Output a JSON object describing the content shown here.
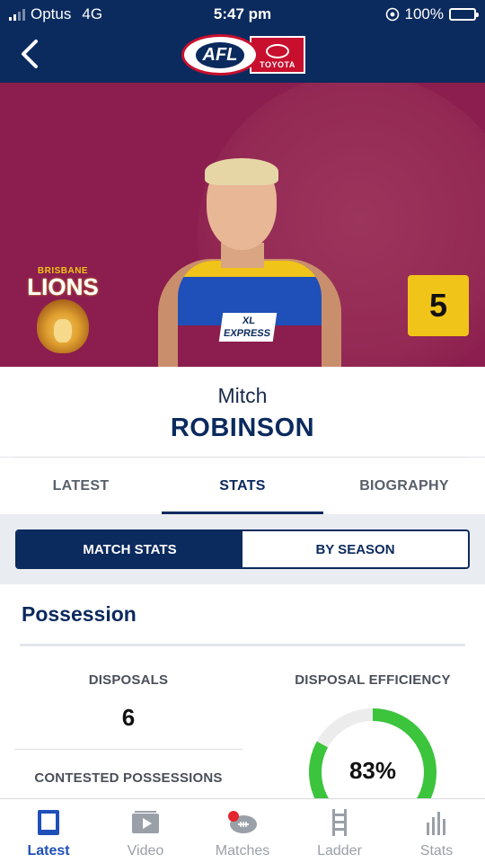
{
  "status_bar": {
    "carrier": "Optus",
    "network": "4G",
    "time": "5:47 pm",
    "battery": "100%",
    "battery_level": 1.0
  },
  "header": {
    "back_icon": "chevron-left-icon",
    "logo_text": "AFL",
    "sponsor_text": "TOYOTA"
  },
  "hero": {
    "club_small": "BRISBANE",
    "club_name": "LIONS",
    "player_number": "5",
    "guernsey_sponsor": "XL EXPRESS",
    "colors": {
      "maroon": "#8b1e4e",
      "gold": "#f0c419",
      "blue": "#1f4fb8"
    }
  },
  "player": {
    "first_name": "Mitch",
    "last_name": "ROBINSON"
  },
  "tabs": [
    {
      "label": "LATEST",
      "active": false
    },
    {
      "label": "STATS",
      "active": true
    },
    {
      "label": "BIOGRAPHY",
      "active": false
    }
  ],
  "segment": {
    "options": [
      {
        "label": "MATCH STATS",
        "selected": true
      },
      {
        "label": "BY SEASON",
        "selected": false
      }
    ]
  },
  "stats": {
    "section_title": "Possession",
    "disposals_label": "DISPOSALS",
    "disposals_value": "6",
    "contested_label": "CONTESTED POSSESSIONS",
    "efficiency_label": "DISPOSAL EFFICIENCY",
    "efficiency_value": "83%",
    "efficiency_fraction": 0.83,
    "ring_color": "#3cc43c"
  },
  "bottom_nav": [
    {
      "label": "Latest",
      "icon": "tablet-icon",
      "active": true
    },
    {
      "label": "Video",
      "icon": "play-icon",
      "active": false
    },
    {
      "label": "Matches",
      "icon": "football-icon",
      "active": false
    },
    {
      "label": "Ladder",
      "icon": "ladder-icon",
      "active": false
    },
    {
      "label": "Stats",
      "icon": "bar-chart-icon",
      "active": false
    }
  ],
  "theme": {
    "navy": "#0b2a5e",
    "accent_blue": "#1f4fb8"
  }
}
